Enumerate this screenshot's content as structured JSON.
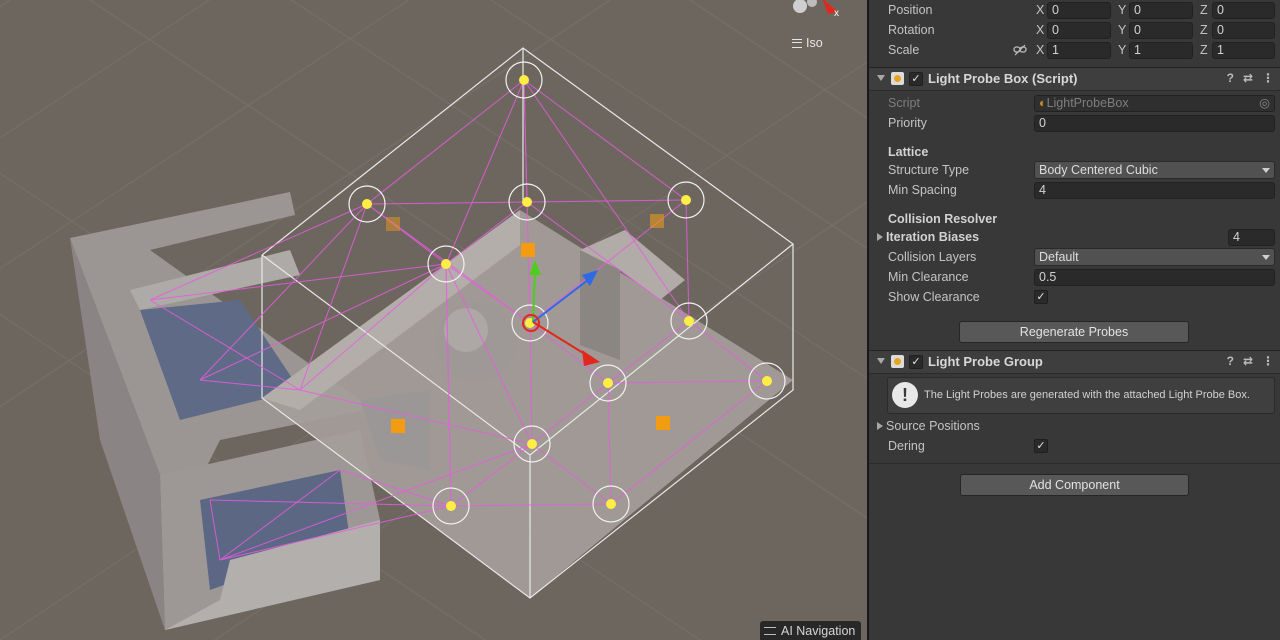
{
  "scene": {
    "projection_label": "Iso",
    "overlay_label": "AI Navigation",
    "icons": [
      "scene-gizmo-icon",
      "light-probe-icon",
      "light-icon",
      "move-handle-icon"
    ],
    "colors": {
      "probe": "#ffee44",
      "probe_lines": "#e85be0",
      "bounds": "#e8e8e8",
      "x_axis": "#e0281e",
      "y_axis": "#4fcd1c",
      "z_axis": "#2e6ae8"
    }
  },
  "transform": {
    "position": {
      "label": "Position",
      "x": "0",
      "y": "0",
      "z": "0"
    },
    "rotation": {
      "label": "Rotation",
      "x": "0",
      "y": "0",
      "z": "0"
    },
    "scale": {
      "label": "Scale",
      "x": "1",
      "y": "1",
      "z": "1"
    },
    "axis_x": "X",
    "axis_y": "Y",
    "axis_z": "Z"
  },
  "probe_box": {
    "title": "Light Probe Box (Script)",
    "script_label": "Script",
    "script_value": "LightProbeBox",
    "priority_label": "Priority",
    "priority_value": "0",
    "lattice_heading": "Lattice",
    "structure_label": "Structure Type",
    "structure_value": "Body Centered Cubic",
    "min_spacing_label": "Min Spacing",
    "min_spacing_value": "4",
    "collision_heading": "Collision Resolver",
    "iteration_label": "Iteration Biases",
    "iteration_value": "4",
    "layers_label": "Collision Layers",
    "layers_value": "Default",
    "min_clearance_label": "Min Clearance",
    "min_clearance_value": "0.5",
    "show_clearance_label": "Show Clearance",
    "show_clearance_checked": true,
    "regenerate_label": "Regenerate Probes"
  },
  "probe_group": {
    "title": "Light Probe Group",
    "help_text": "The Light Probes are generated with the attached Light Probe Box.",
    "source_positions_label": "Source Positions",
    "dering_label": "Dering",
    "dering_checked": true
  },
  "add_component_label": "Add Component",
  "header_icons": [
    "help-icon",
    "presets-icon",
    "more-icon"
  ]
}
